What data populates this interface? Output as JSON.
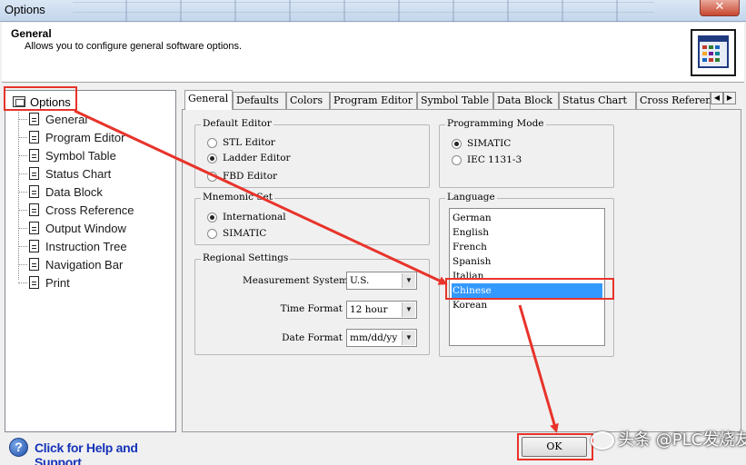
{
  "window": {
    "title": "Options",
    "close_symbol": "✕"
  },
  "header": {
    "title": "General",
    "description": "Allows you to configure general software options."
  },
  "tree": {
    "root_label": "Options",
    "items": [
      {
        "label": "General"
      },
      {
        "label": "Program Editor"
      },
      {
        "label": "Symbol Table"
      },
      {
        "label": "Status Chart"
      },
      {
        "label": "Data Block"
      },
      {
        "label": "Cross Reference"
      },
      {
        "label": "Output Window"
      },
      {
        "label": "Instruction Tree"
      },
      {
        "label": "Navigation Bar"
      },
      {
        "label": "Print"
      }
    ]
  },
  "help": {
    "label": "Click for Help and Support",
    "icon": "?"
  },
  "tabs": [
    {
      "label": "General",
      "active": true
    },
    {
      "label": "Defaults"
    },
    {
      "label": "Colors"
    },
    {
      "label": "Program Editor"
    },
    {
      "label": "Symbol Table"
    },
    {
      "label": "Data Block"
    },
    {
      "label": "Status Chart"
    },
    {
      "label": "Cross Reference"
    }
  ],
  "default_editor": {
    "legend": "Default Editor",
    "options": [
      "STL Editor",
      "Ladder Editor",
      "FBD Editor"
    ],
    "selected": "Ladder Editor"
  },
  "mnemonic_set": {
    "legend": "Mnemonic Set",
    "options": [
      "International",
      "SIMATIC"
    ],
    "selected": "International"
  },
  "programming_mode": {
    "legend": "Programming Mode",
    "options": [
      "SIMATIC",
      "IEC 1131-3"
    ],
    "selected": "SIMATIC"
  },
  "regional": {
    "legend": "Regional Settings",
    "measurement_label": "Measurement System",
    "measurement_value": "U.S.",
    "time_label": "Time Format",
    "time_value": "12 hour",
    "date_label": "Date Format",
    "date_value": "mm/dd/yy"
  },
  "language": {
    "legend": "Language",
    "options": [
      "German",
      "English",
      "French",
      "Spanish",
      "Italian",
      "Chinese",
      "Korean"
    ],
    "selected": "Chinese"
  },
  "buttons": {
    "ok": "OK"
  },
  "watermark": "头条 @PLC发烧友",
  "colors": {
    "annotation": "#e8332a",
    "selection": "#3399ff",
    "help_link": "#1633b8"
  }
}
